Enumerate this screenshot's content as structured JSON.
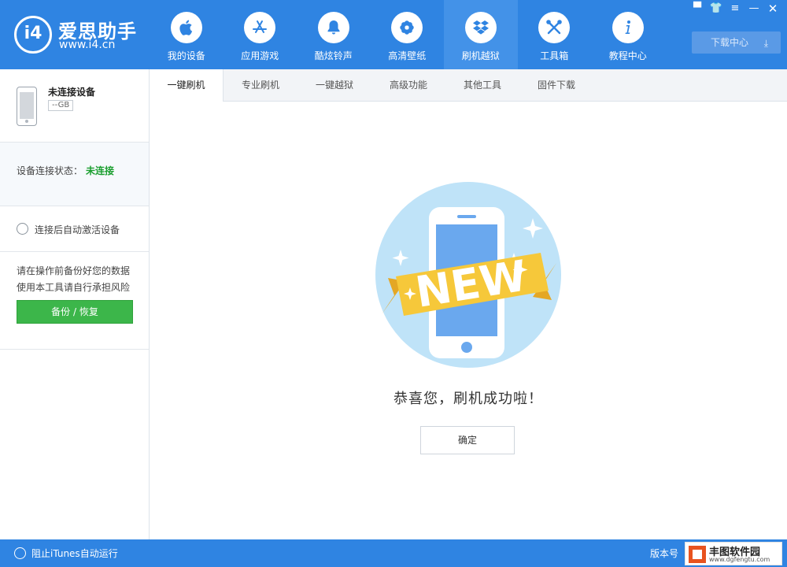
{
  "app": {
    "logo_mark": "i4",
    "logo_name": "爱思助手",
    "logo_url": "www.i4.cn"
  },
  "nav": [
    {
      "label": "我的设备",
      "icon": "apple-icon",
      "active": false
    },
    {
      "label": "应用游戏",
      "icon": "app-store-icon",
      "active": false
    },
    {
      "label": "酷炫铃声",
      "icon": "bell-icon",
      "active": false
    },
    {
      "label": "高清壁纸",
      "icon": "flower-icon",
      "active": false
    },
    {
      "label": "刷机越狱",
      "icon": "dropbox-icon",
      "active": true
    },
    {
      "label": "工具箱",
      "icon": "tools-icon",
      "active": false
    },
    {
      "label": "教程中心",
      "icon": "info-icon",
      "active": false
    }
  ],
  "window_controls": [
    "feedback-icon",
    "skin-icon",
    "menu-icon",
    "minimize-icon",
    "close-icon"
  ],
  "download_center": {
    "label": "下载中心",
    "icon": "download-icon"
  },
  "device": {
    "name": "未连接设备",
    "capacity": "--GB"
  },
  "connection": {
    "label": "设备连接状态：",
    "value": "未连接",
    "value_color": "#1a9e2e"
  },
  "auto_activate": {
    "label": "连接后自动激活设备",
    "checked": false
  },
  "warning": {
    "line1": "请在操作前备份好您的数据",
    "line2": "使用本工具请自行承担风险"
  },
  "backup_button": {
    "label": "备份 / 恢复"
  },
  "tabs": [
    {
      "label": "一键刷机",
      "active": true
    },
    {
      "label": "专业刷机",
      "active": false
    },
    {
      "label": "一键越狱",
      "active": false
    },
    {
      "label": "高级功能",
      "active": false
    },
    {
      "label": "其他工具",
      "active": false
    },
    {
      "label": "固件下载",
      "active": false
    }
  ],
  "illustration": {
    "banner_text": "NEW"
  },
  "success_message": "恭喜您，刷机成功啦！",
  "confirm_button": {
    "label": "确定"
  },
  "bottom": {
    "itunes_label": "阻止iTunes自动运行",
    "version_label": "版本号"
  },
  "watermark": {
    "name": "丰图软件园",
    "url": "www.dgfengtu.com"
  },
  "colors": {
    "brand_blue": "#2f84e2",
    "green_button": "#3cb64a",
    "banner_yellow": "#f6c83a"
  }
}
